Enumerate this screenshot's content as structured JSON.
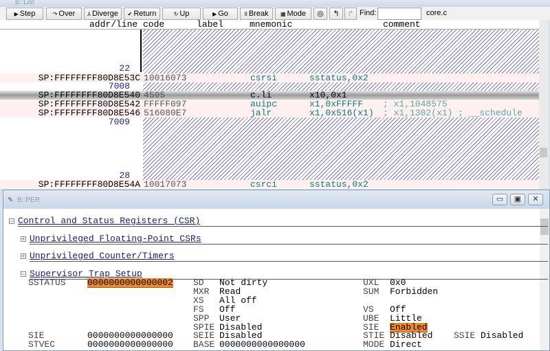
{
  "list_window": {
    "title": "B::List",
    "toolbar": {
      "step": "Step",
      "over": "Over",
      "diverge": "Diverge",
      "return": "Return",
      "up": "Up",
      "go": "Go",
      "break": "Break",
      "mode": "Mode",
      "find_label": "Find:",
      "find_value": "",
      "module": "core.c"
    },
    "columns": [
      "addr/line",
      "code",
      "label",
      "mnemonic",
      "comment"
    ],
    "rows": [
      {
        "type": "line",
        "text": "22"
      },
      {
        "type": "instr",
        "addr": "SP:FFFFFFFF80D8E53C",
        "code": "10016073",
        "mnemonic": "csrsi",
        "operands": "sstatus,0x2",
        "comment": ""
      },
      {
        "type": "line",
        "text": "7008"
      },
      {
        "type": "instr",
        "addr": "SP:FFFFFFFF80D8E540",
        "code": "4505",
        "mnemonic": "c.li",
        "operands": "x10,0x1",
        "comment": "",
        "current": true
      },
      {
        "type": "instr",
        "addr": "SP:FFFFFFFF80D8E542",
        "code": "FFFFF097",
        "mnemonic": "auipc",
        "operands": "x1,0xFFFFF",
        "comment": "; x1,1048575"
      },
      {
        "type": "instr",
        "addr": "SP:FFFFFFFF80D8E546",
        "code": "516080E7",
        "mnemonic": "jalr",
        "operands": "x1,0x516(x1)",
        "comment": "; x1,1302(x1) ; __schedule"
      },
      {
        "type": "line",
        "text": "7009"
      },
      {
        "type": "line",
        "text": "28"
      },
      {
        "type": "instr",
        "addr": "SP:FFFFFFFF80D8E54A",
        "code": "10017073",
        "mnemonic": "csrci",
        "operands": "sstatus,0x2",
        "comment": ""
      }
    ]
  },
  "per_window": {
    "title": "B::PER",
    "sections": {
      "csr": "Control and Status Registers (CSR)",
      "fp": "Unprivileged Floating-Point CSRs",
      "counters": "Unprivileged Counter/Timers",
      "trap": "Supervisor Trap Setup"
    },
    "regs": {
      "sstatus": {
        "name": "SSTATUS",
        "value": "0000000000000002"
      },
      "sie": {
        "name": "SIE",
        "value": "0000000000000000"
      },
      "stvec": {
        "name": "STVEC",
        "value": "0000000000000000"
      }
    },
    "fields": [
      [
        "SD",
        "Not dirty",
        "UXL",
        "0x0"
      ],
      [
        "MXR",
        "Read",
        "SUM",
        "Forbidden"
      ],
      [
        "XS",
        "All off",
        "",
        ""
      ],
      [
        "FS",
        "Off",
        "VS",
        "Off"
      ],
      [
        "SPP",
        "User",
        "UBE",
        "Little"
      ],
      [
        "SPIE",
        "Disabled",
        "SIE",
        "Enabled"
      ],
      [
        "SEIE",
        "Disabled",
        "STIE",
        "Disabled",
        "SSIE",
        "Disabled"
      ],
      [
        "BASE",
        "0000000000000000",
        "MODE",
        "Direct"
      ]
    ]
  }
}
